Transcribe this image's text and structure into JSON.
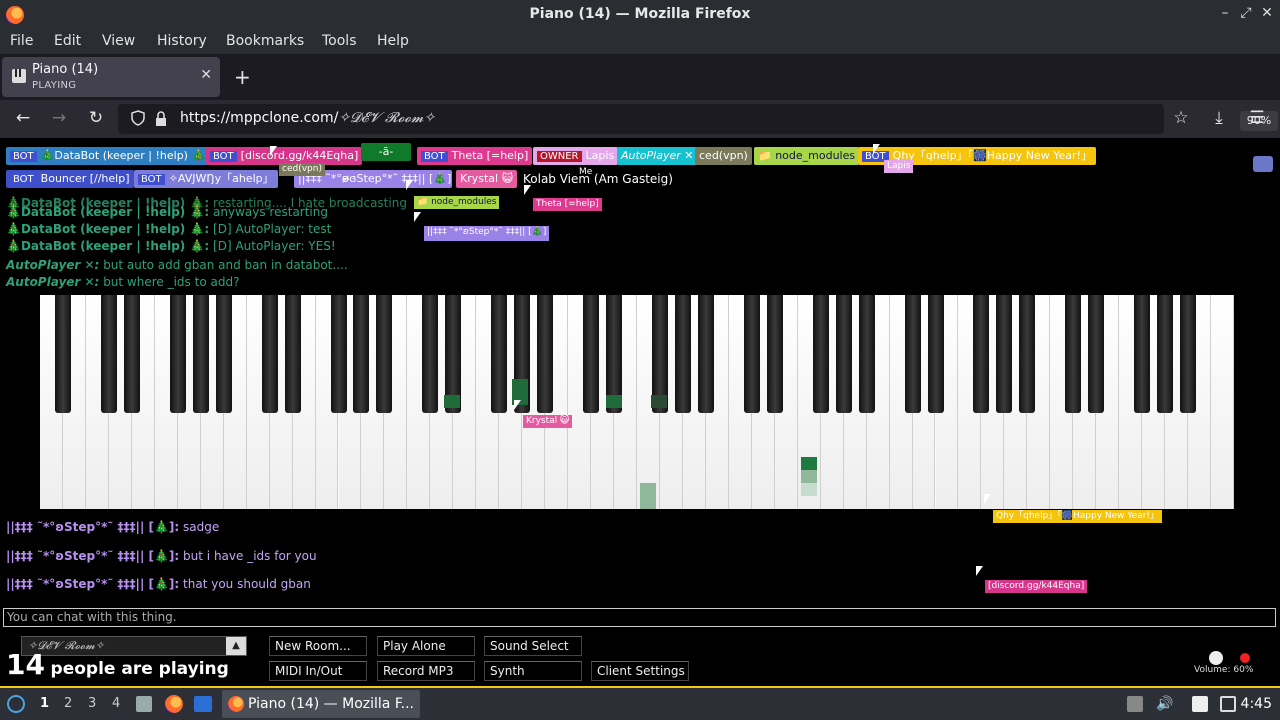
{
  "window": {
    "title": "Piano (14) — Mozilla Firefox"
  },
  "menu": [
    "File",
    "Edit",
    "View",
    "History",
    "Bookmarks",
    "Tools",
    "Help"
  ],
  "tab": {
    "title": "Piano (14)",
    "subtitle": "PLAYING"
  },
  "address": {
    "url": "https://mppclone.com/",
    "room_suffix": "✧𝓓𝓔𝓥 𝓡𝓸𝓸𝓶✧",
    "zoom": "90%"
  },
  "badge_bot": "BOT",
  "badge_owner": "OWNER",
  "top_users": [
    {
      "name": "🎄DataBot (keeper | !help) 🎄",
      "bot": true,
      "color": "#2e7fc2"
    },
    {
      "name": "[discord.gg/k44Eqha]",
      "bot": true,
      "color": "#d6368a"
    },
    {
      "name": "-ā-",
      "bot": false,
      "color": "#107a2b"
    },
    {
      "name": "Theta [=help]",
      "bot": true,
      "color": "#dd3a8f"
    },
    {
      "name": "Lapis",
      "owner": true,
      "color": "#e4a7ea"
    },
    {
      "name": "AutoPlayer ✕",
      "bot": false,
      "color": "#16c2cf"
    },
    {
      "name": "ced(vpn)",
      "bot": false,
      "color": "#7a7a5a"
    },
    {
      "name": "📁 node_modules",
      "bot": false,
      "color": "#a7d64a"
    },
    {
      "name": "Qhy「qhelp」「🎆Happy New Year!」",
      "bot": true,
      "color": "#f5c40c"
    },
    {
      "name": "Bouncer [//help]",
      "bot": true,
      "color": "#3e4fc8"
    },
    {
      "name": "✧AVJWŊy「ahelp」",
      "bot": true,
      "color": "#7d7cd9"
    },
    {
      "name": "||‡‡‡ ˜*°ʚ̴̶̷̷ɞStep°*˜ ‡‡‡|| [🎄]",
      "bot": false,
      "color": "#9a82e6"
    },
    {
      "name": "Krystal 😺",
      "bot": false,
      "color": "#e45ba0"
    },
    {
      "name": "Kolab Viem (Am Gasteig)",
      "bot": false,
      "color": "#000000"
    }
  ],
  "cursor_labels": {
    "ced": "ced(vpn)",
    "me": "Me",
    "lapis": "Lapis",
    "node": "📁 node_modules",
    "theta": "Theta [=help]",
    "step": "||‡‡‡ ˜*°ʚStep°*˜ ‡‡‡|| [🎄]",
    "krystal": "Krystal 😺",
    "qhy": "Qhy「qhelp」「🎆Happy New Year!」",
    "discord": "[discord.gg/k44Eqha]"
  },
  "chat": [
    {
      "name": "🎄DataBot (keeper | !help) 🎄:",
      "text": "restarting.... I hate broadcasting"
    },
    {
      "name": "🎄DataBot (keeper | !help) 🎄:",
      "text": "anyways restarting"
    },
    {
      "name": "🎄DataBot (keeper | !help) 🎄:",
      "text": "[D] AutoPlayer: test"
    },
    {
      "name": "🎄DataBot (keeper | !help) 🎄:",
      "text": "[D] AutoPlayer: YES!"
    },
    {
      "name": "AutoPlayer ✕:",
      "text": "but auto add gban and ban in databot...."
    },
    {
      "name": "AutoPlayer ✕:",
      "text": "but where _ids to add?"
    }
  ],
  "chat_below": [
    {
      "name": "||‡‡‡ ˜*°ʚStep°*˜ ‡‡‡|| [🎄]:",
      "text": "sadge"
    },
    {
      "name": "||‡‡‡ ˜*°ʚStep°*˜ ‡‡‡|| [🎄]:",
      "text": "but i have _ids for you"
    },
    {
      "name": "||‡‡‡ ˜*°ʚStep°*˜ ‡‡‡|| [🎄]:",
      "text": "that you should gban"
    }
  ],
  "chat_input": {
    "placeholder": "You can chat with this thing."
  },
  "room_select": "✧𝓓𝓔𝓥 𝓡𝓸𝓸𝓶✧",
  "people": {
    "count": "14",
    "label": "people are playing"
  },
  "buttons": {
    "new_room": "New Room...",
    "play_alone": "Play Alone",
    "sound_select": "Sound Select",
    "midi": "MIDI In/Out",
    "record": "Record MP3",
    "synth": "Synth",
    "client_settings": "Client Settings"
  },
  "volume": "Volume: 60%",
  "taskbar": {
    "workspaces": [
      "1",
      "2",
      "3",
      "4"
    ],
    "task_label": "Piano (14) — Mozilla F...",
    "clock": "4:45"
  },
  "colors": {
    "accent": "#f3c615",
    "chat_green": "#2fa17a",
    "chat_purple": "#c2a6f5"
  }
}
